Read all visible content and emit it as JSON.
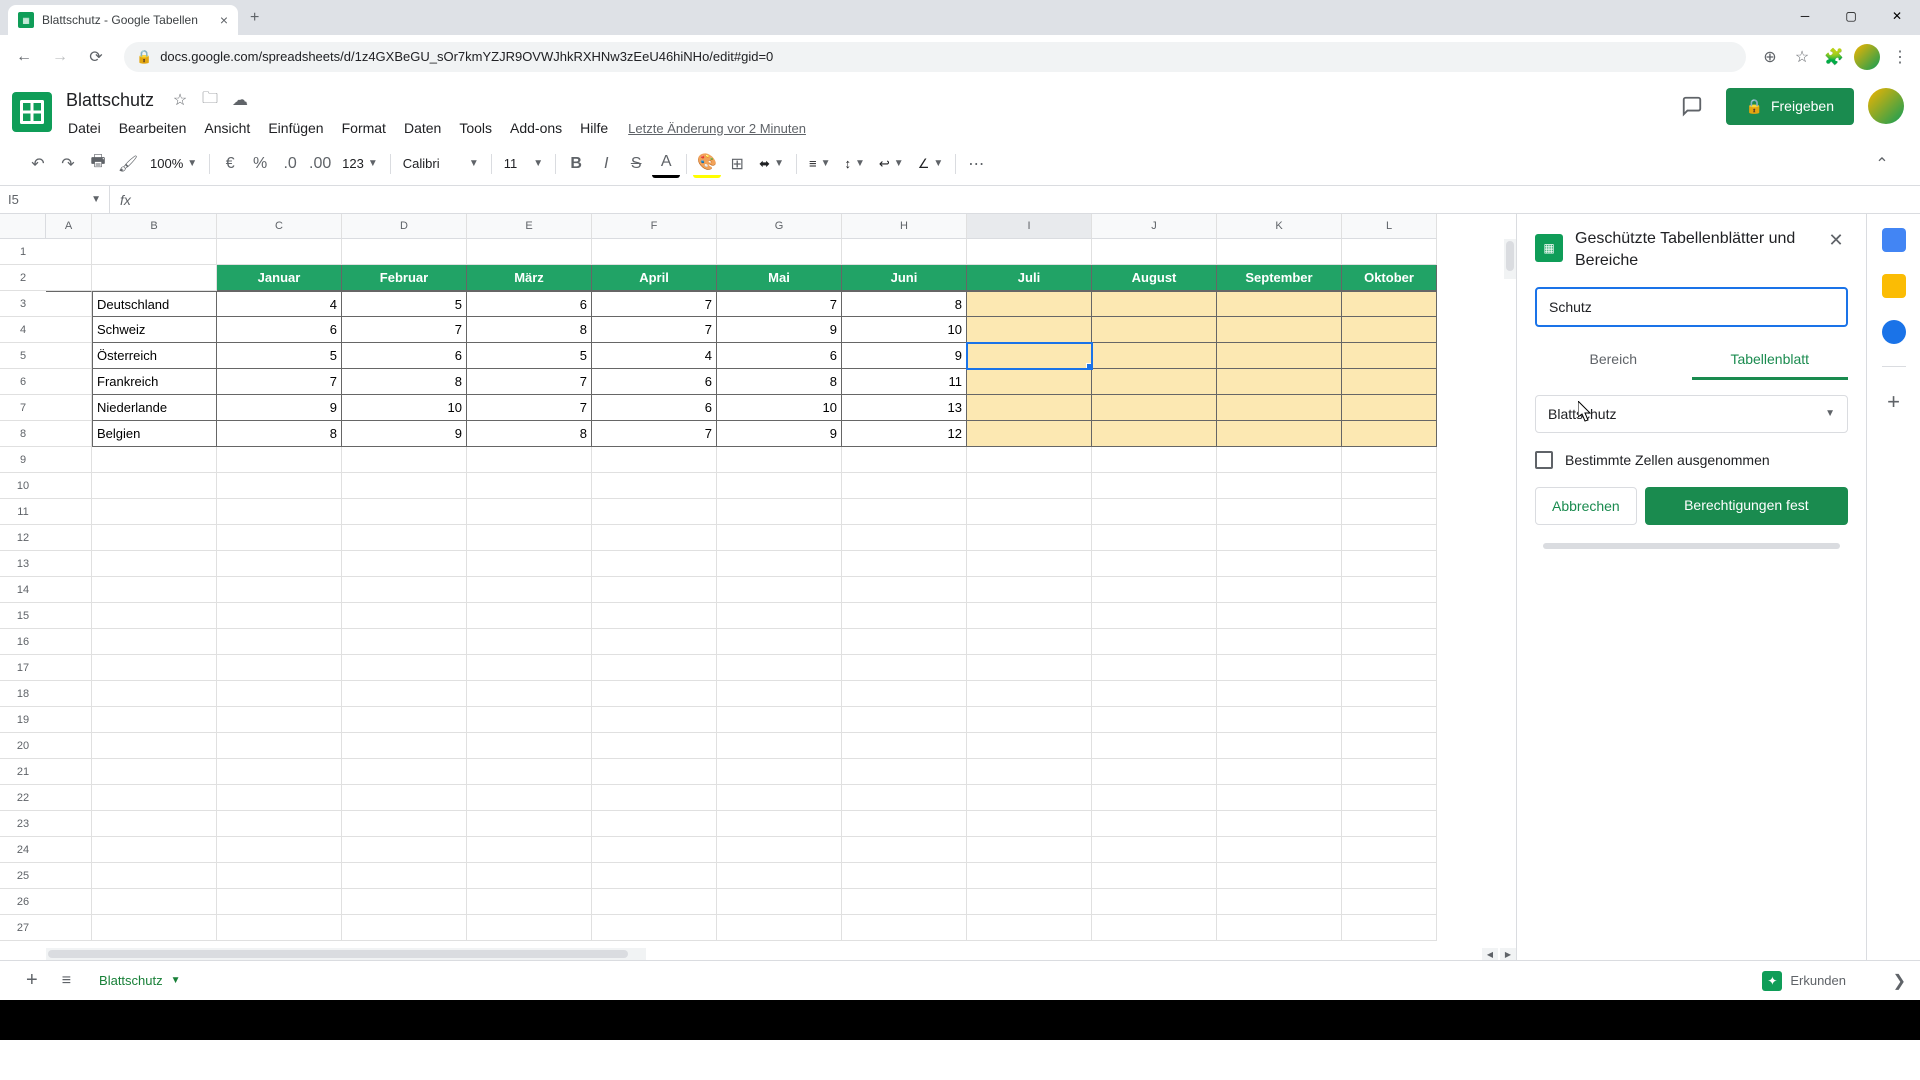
{
  "browser": {
    "tab_title": "Blattschutz - Google Tabellen",
    "url": "docs.google.com/spreadsheets/d/1z4GXBeGU_sOr7kmYZJR9OVWJhkRXHNw3zEeU46hiNHo/edit#gid=0"
  },
  "header": {
    "doc_title": "Blattschutz",
    "menus": [
      "Datei",
      "Bearbeiten",
      "Ansicht",
      "Einfügen",
      "Format",
      "Daten",
      "Tools",
      "Add-ons",
      "Hilfe"
    ],
    "last_edit": "Letzte Änderung vor 2 Minuten",
    "share_label": "Freigeben"
  },
  "toolbar": {
    "zoom": "100%",
    "number_format": "123",
    "font": "Calibri",
    "font_size": "11"
  },
  "formula_bar": {
    "name_box": "I5",
    "formula": ""
  },
  "grid": {
    "columns": [
      "A",
      "B",
      "C",
      "D",
      "E",
      "F",
      "G",
      "H",
      "I",
      "J",
      "K",
      "L"
    ],
    "selected_col": "I",
    "selected_cell": {
      "row": 5,
      "col": "I"
    },
    "rows_shown": 27,
    "table": {
      "header_row": 2,
      "headers": [
        "Januar",
        "Februar",
        "März",
        "April",
        "Mai",
        "Juni",
        "Juli",
        "August",
        "September",
        "Oktober"
      ],
      "data_start_col": "C",
      "label_col": "B",
      "rows": [
        {
          "row": 3,
          "label": "Deutschland",
          "values": [
            "4",
            "5",
            "6",
            "7",
            "7",
            "8"
          ]
        },
        {
          "row": 4,
          "label": "Schweiz",
          "values": [
            "6",
            "7",
            "8",
            "7",
            "9",
            "10"
          ]
        },
        {
          "row": 5,
          "label": "Österreich",
          "values": [
            "5",
            "6",
            "5",
            "4",
            "6",
            "9"
          ]
        },
        {
          "row": 6,
          "label": "Frankreich",
          "values": [
            "7",
            "8",
            "7",
            "6",
            "8",
            "11"
          ]
        },
        {
          "row": 7,
          "label": "Niederlande",
          "values": [
            "9",
            "10",
            "7",
            "6",
            "10",
            "13"
          ]
        },
        {
          "row": 8,
          "label": "Belgien",
          "values": [
            "8",
            "9",
            "8",
            "7",
            "9",
            "12"
          ]
        }
      ]
    }
  },
  "side_panel": {
    "title": "Geschützte Tabellenblätter und Bereiche",
    "input_value": "Schutz",
    "tab_range": "Bereich",
    "tab_sheet": "Tabellenblatt",
    "select_value": "Blattschutz",
    "checkbox_label": "Bestimmte Zellen ausgenommen",
    "cancel": "Abbrechen",
    "confirm": "Berechtigungen fest"
  },
  "sheet_tabs": {
    "active": "Blattschutz",
    "explore": "Erkunden"
  },
  "chart_data": {
    "type": "table",
    "title": "",
    "columns": [
      "Januar",
      "Februar",
      "März",
      "April",
      "Mai",
      "Juni",
      "Juli",
      "August",
      "September",
      "Oktober"
    ],
    "rows": {
      "Deutschland": [
        4,
        5,
        6,
        7,
        7,
        8,
        null,
        null,
        null,
        null
      ],
      "Schweiz": [
        6,
        7,
        8,
        7,
        9,
        10,
        null,
        null,
        null,
        null
      ],
      "Österreich": [
        5,
        6,
        5,
        4,
        6,
        9,
        null,
        null,
        null,
        null
      ],
      "Frankreich": [
        7,
        8,
        7,
        6,
        8,
        11,
        null,
        null,
        null,
        null
      ],
      "Niederlande": [
        9,
        10,
        7,
        6,
        10,
        13,
        null,
        null,
        null,
        null
      ],
      "Belgien": [
        8,
        9,
        8,
        7,
        9,
        12,
        null,
        null,
        null,
        null
      ]
    }
  }
}
